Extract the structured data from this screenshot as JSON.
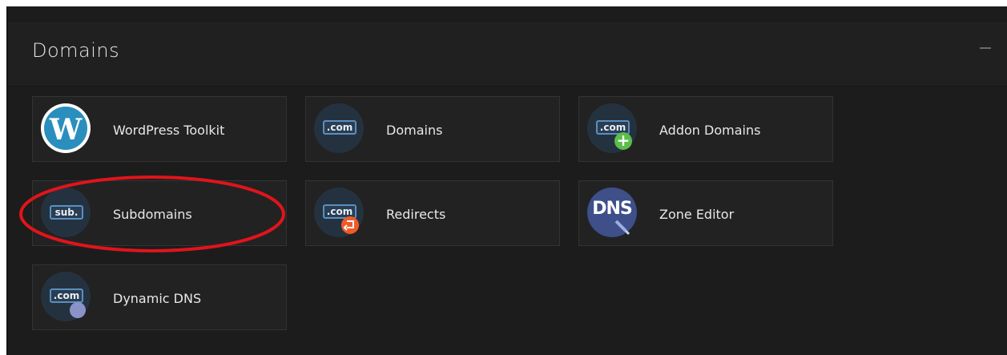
{
  "panel": {
    "title": "Domains",
    "collapse_label": "—"
  },
  "tiles": [
    {
      "label": "WordPress Toolkit",
      "icon": "wordpress-icon"
    },
    {
      "label": "Domains",
      "icon": "dotcom-icon",
      "badge": ".com"
    },
    {
      "label": "Addon Domains",
      "icon": "addon-domains-icon",
      "badge": ".com"
    },
    {
      "label": "Subdomains",
      "icon": "subdomain-icon",
      "badge": "sub."
    },
    {
      "label": "Redirects",
      "icon": "redirects-icon",
      "badge": ".com"
    },
    {
      "label": "Zone Editor",
      "icon": "dns-icon",
      "badge": "DNS"
    },
    {
      "label": "Dynamic DNS",
      "icon": "dynamic-dns-icon",
      "badge": ".com"
    }
  ],
  "annotation": {
    "color": "#e0141b",
    "target": "Subdomains"
  },
  "colors": {
    "panel_bg": "#1c1c1c",
    "tile_bg": "#222222",
    "icon_bg": "#243240",
    "accent_blue": "#5b8fbf"
  }
}
